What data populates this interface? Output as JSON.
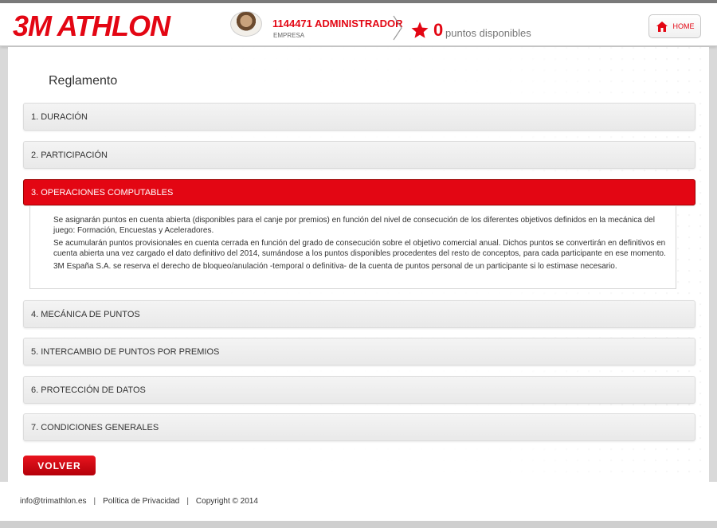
{
  "header": {
    "logo_text": "3M ATHLON",
    "user_name": "1144471 ADMINISTRADOR",
    "user_role": "EMPRESA",
    "points_value": "0",
    "points_label": "puntos disponibles",
    "home_label": "HOME",
    "brand_color": "#e30613"
  },
  "main": {
    "title": "Reglamento",
    "sections": [
      {
        "label": "1. DURACIÓN"
      },
      {
        "label": "2. PARTICIPACIÓN"
      },
      {
        "label": "3. OPERACIONES COMPUTABLES"
      },
      {
        "label": "4. MECÁNICA DE PUNTOS"
      },
      {
        "label": "5. INTERCAMBIO DE PUNTOS POR PREMIOS"
      },
      {
        "label": "6. PROTECCIÓN DE DATOS"
      },
      {
        "label": "7. CONDICIONES GENERALES"
      }
    ],
    "expanded_paragraphs": [
      "Se asignarán puntos en cuenta abierta (disponibles para el canje por premios) en función del nivel de consecución de los diferentes objetivos definidos en la mecánica del juego: Formación, Encuestas y Aceleradores.",
      "Se acumularán puntos provisionales en cuenta cerrada en función del grado de consecución sobre el objetivo comercial anual. Dichos puntos se convertirán en definitivos en cuenta abierta una vez cargado el dato definitivo del 2014, sumándose a los puntos disponibles procedentes del resto de conceptos, para cada participante en ese momento.",
      "3M España S.A. se reserva el derecho de bloqueo/anulación -temporal o definitiva- de la cuenta de puntos personal de un participante si lo estimase necesario."
    ],
    "back_label": "VOLVER"
  },
  "footer": {
    "email": "info@trimathlon.es",
    "separator": "|",
    "privacy": "Política de Privacidad",
    "copyright": "Copyright © 2014"
  }
}
